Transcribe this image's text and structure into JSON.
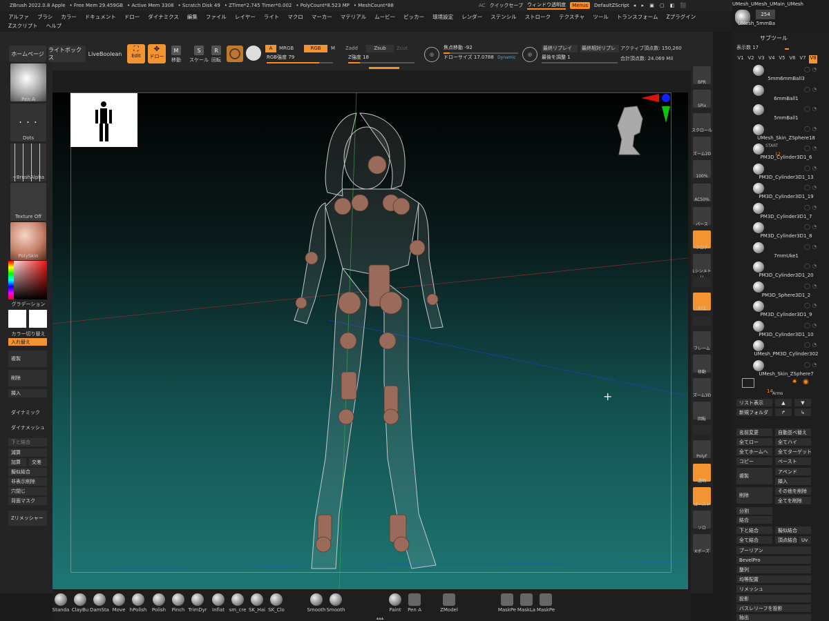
{
  "titlebar": {
    "app": "ZBrush 2022.0.8 Apple",
    "free_mem": "• Free Mem 29.459GB",
    "active_mem": "• Active Mem 3308",
    "scratch": "• Scratch Disk 49",
    "ztime": "• ZTime*2.745 Timer*0.002",
    "polycount": "• PolyCount*8.523 MP",
    "meshcount": "• MeshCount*88"
  },
  "quickbar": {
    "ac": "AC",
    "quicksave": "クイックセーブ",
    "window_trans": "ウィンドウ透明度",
    "menus": "Menus",
    "script": "DefaultZScript"
  },
  "menus": [
    "アルファ",
    "ブラシ",
    "カラー",
    "ドキュメント",
    "ドロー",
    "ダイナミクス",
    "編集",
    "ファイル",
    "レイヤー",
    "ライト",
    "マクロ",
    "マーカー",
    "マテリアル",
    "ムービー",
    "ピッカー",
    "環境設定",
    "レンダー",
    "ステンシル",
    "ストローク",
    "テクスチャ",
    "ツール",
    "トランスフォーム",
    "Zプラグイン",
    "Zスクリプト",
    "ヘルプ"
  ],
  "toolbar": {
    "home": "ホームページ",
    "lightbox": "ライトボックス",
    "liveboolean": "LiveBoolean",
    "edit": "Edit",
    "draw": "ドロー",
    "move": "移動",
    "scale": "スケール",
    "rotate": "回転",
    "a_btn": "A",
    "mrgb": "MRGB",
    "rgb": "RGB",
    "m": "M",
    "zadd": "Zadd",
    "zsub": "Zsub",
    "zcut": "Zcut",
    "rgb_intensity": "RGB強度 79",
    "z_intensity": "Z強度 18",
    "focal_shift": "焦点移動 -92",
    "draw_size": "ドローサイズ 17.0788",
    "dynamic": "Dynamic",
    "sym_replay": "最終リプレイ",
    "sym_relative": "最終相対リプレ",
    "last_adjust": "最後を調整 1",
    "active_points": "アクティブ頂点数: 150,260",
    "total_points": "合計頂点数: 24.069 Mil"
  },
  "left": {
    "pen": "Pen A",
    "dots": "Dots",
    "alpha": "~BrushAlpha",
    "texture": "Texture Off",
    "material": "PolySkin",
    "gradient": "グラデーション",
    "color_switch": "カラー切り替え",
    "swap": "入れ替え",
    "duplicate": "複製",
    "delete": "削除",
    "insert": "挿入",
    "dynamic": "ダイナミック",
    "dynamesh": "ダイナメッシュ",
    "merge_down": "下と結合",
    "subtract": "減算",
    "add": "加算",
    "intersect": "交差",
    "boolean_merge": "擬似結合",
    "del_hidden": "非表示削除",
    "close_holes": "穴閉じ",
    "back_mask": "背面マスク",
    "zremesher": "Zリメッシャー"
  },
  "rightcol": [
    "BPR",
    "SPix",
    "スクロール",
    "ズーム2D",
    "100%",
    "AC50%",
    "パース",
    "フロア",
    "Lシンメトリ",
    "",
    "XYZ",
    "",
    "フレーム",
    "移動",
    "ズーム3D",
    "回転",
    "",
    "PolyF",
    "透明",
    "ゴースト",
    "ソロ",
    "Xポーズ"
  ],
  "subtool": {
    "header": "サブツール",
    "visible_count": "表示数 17",
    "versions": [
      "V1",
      "V2",
      "V3",
      "V4",
      "V5",
      "V6",
      "V7",
      "V8"
    ],
    "top_names": [
      "UMesh_UMesh_UMain_UMesh",
      "254",
      "UMesh_5mmBa"
    ],
    "items": [
      "5mm6mmBall3",
      "6mmBall1",
      "5mmBall1",
      "UMesh_Skin_ZSphere18",
      "PM3D_Cylinder3D1_6",
      "PM3D_Cylinder3D1_13",
      "PM3D_Cylinder3D1_19",
      "PM3D_Cylinder3D1_7",
      "PM3D_Cylinder3D1_8",
      "7mmUke1",
      "PM3D_Cylinder3D1_20",
      "PM3D_Sphere3D1_2",
      "PM3D_Cylinder3D1_9",
      "PM3D_Cylinder3D1_10",
      "UMesh_PM3D_Cylinder302",
      "UMesh_Skin_ZSphere7"
    ],
    "start": "START",
    "start_num": "12",
    "arms": "Arms",
    "arms_num": "14",
    "list": "リスト表示",
    "new_folder": "新規フォルダ",
    "rename": "名前変更",
    "auto_reorder": "自動並べ替え",
    "all_low": "全てロー",
    "all_high": "全てハイ",
    "all_home": "全てホームへ",
    "all_target": "全てターゲット",
    "copy": "コピー",
    "paste": "ペースト",
    "append": "アペンド",
    "duplicate": "複製",
    "insert": "挿入",
    "delete": "削除",
    "del_other": "その他を削除",
    "del_all": "全てを削除",
    "split": "分割",
    "merge": "結合",
    "merge_down": "下と結合",
    "boolean_merge": "擬似結合",
    "merge_all": "全て結合",
    "vertex_uv": "頂点結合",
    "uv": "Uv",
    "boolean": "ブーリアン",
    "bevelpro": "BevelPro",
    "align": "整列",
    "distribute": "均等配置",
    "remesh": "リメッシュ",
    "project": "投影",
    "project_bas": "バスレリーフを投影",
    "extract": "抽出"
  },
  "bottom": [
    "Standa",
    "ClayBu",
    "DamSta",
    "Move",
    "hPolish",
    "Polish",
    "Pinch",
    "TrimDyr",
    "Inflat",
    "sm_cre",
    "SK_Hai",
    "SK_Clo",
    "Smooth",
    "Smooth",
    "Paint",
    "Pen A",
    "ZModel",
    "MaskPe",
    "MaskLa",
    "MaskPe"
  ]
}
